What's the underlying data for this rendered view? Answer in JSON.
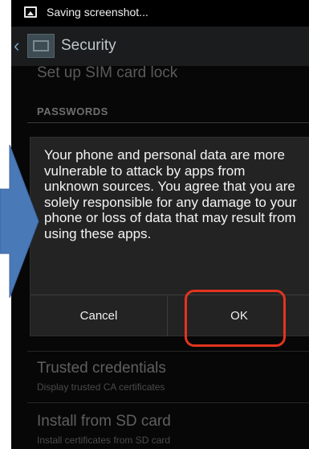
{
  "status_bar": {
    "text": "Saving screenshot...",
    "icon": "image-icon"
  },
  "action_bar": {
    "title": "Security",
    "icon": "settings-app-icon"
  },
  "settings": {
    "sim_lock": "Set up SIM card lock",
    "passwords_header": "PASSWORDS",
    "trusted": {
      "title": "Trusted credentials",
      "subtitle": "Display trusted CA certificates"
    },
    "install": {
      "title": "Install from SD card",
      "subtitle": "Install certificates from SD card"
    }
  },
  "dialog": {
    "message": "Your phone and personal data are more vulnerable to attack by apps from unknown sources. You agree that you are solely responsible for any damage to your phone or loss of data that may result from using these apps.",
    "cancel_label": "Cancel",
    "ok_label": "OK"
  },
  "annotations": {
    "arrow_color": "#4a79b8",
    "highlight_color": "#e3341f"
  }
}
